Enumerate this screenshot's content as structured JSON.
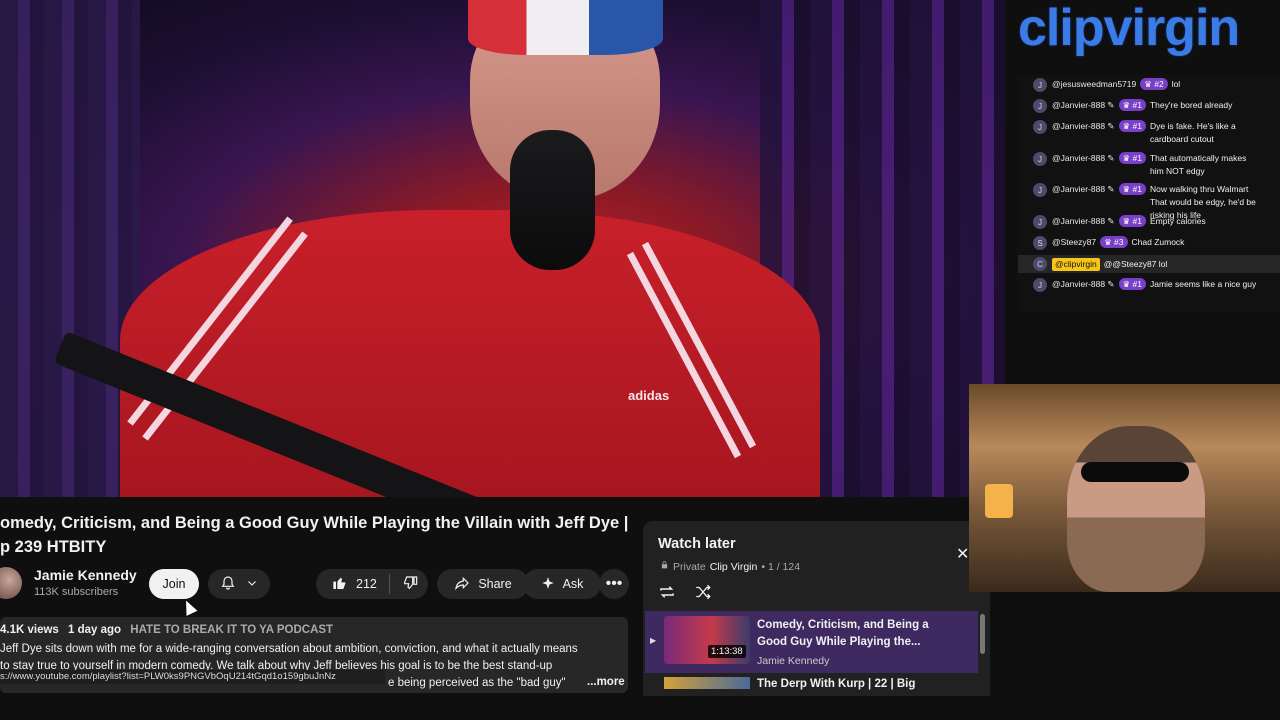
{
  "video": {
    "title_line1": "omedy, Criticism, and Being a Good Guy While Playing the Villain with Jeff Dye |",
    "title_line2": "p 239 HTBITY",
    "overlay_text": "adidas"
  },
  "channel": {
    "name": "Jamie Kennedy",
    "subscribers": "113K subscribers",
    "join_label": "Join"
  },
  "actions": {
    "like_count": "212",
    "share_label": "Share",
    "ask_label": "Ask",
    "more_symbol": "•••"
  },
  "description": {
    "views": "4.1K views",
    "age": "1 day ago",
    "tag": "HATE TO BREAK IT TO YA PODCAST",
    "line1": "Jeff Dye sits down with me for a wide-ranging conversation about ambition, conviction, and what it actually means",
    "line2": "to stay true to yourself in modern comedy. We talk about why Jeff believes his goal is to be the best stand-up",
    "line3": "e being perceived as the \"bad guy\"",
    "more_label": "...more",
    "status_url": "s://www.youtube.com/playlist?list=PLW0ks9PNGVbOqU214tGqd1o159gbuJnNz"
  },
  "watch_later": {
    "title": "Watch later",
    "privacy": "Private",
    "owner": "Clip Virgin",
    "position": "• 1 / 124",
    "close_symbol": "✕",
    "items": [
      {
        "title": "Comedy, Criticism, and Being a Good Guy While Playing the...",
        "channel": "Jamie Kennedy",
        "duration": "1:13:38"
      },
      {
        "title": "The Derp With Kurp | 22 | Big"
      }
    ]
  },
  "overlay": {
    "brand": "clipvirgin",
    "chat": [
      {
        "avatar": "J",
        "user": "@jesusweedman5719",
        "badge": "♛ #2",
        "text": "lol"
      },
      {
        "avatar": "J",
        "user": "@Janvier-888 ✎",
        "badge": "♛ #1",
        "text": "They're bored already"
      },
      {
        "avatar": "J",
        "user": "@Janvier-888 ✎",
        "badge": "♛ #1",
        "text": "Dye is fake. He's like a cardboard cutout"
      },
      {
        "avatar": "J",
        "user": "@Janvier-888 ✎",
        "badge": "♛ #1",
        "text": "That automatically makes him NOT edgy"
      },
      {
        "avatar": "J",
        "user": "@Janvier-888 ✎",
        "badge": "♛ #1",
        "text": "Now walking thru Walmart That would be edgy, he'd be risking his life"
      },
      {
        "avatar": "J",
        "user": "@Janvier-888 ✎",
        "badge": "♛ #1",
        "text": "Empty calories"
      },
      {
        "avatar": "S",
        "user": "@Steezy87",
        "badge": "♛ #3",
        "text": "Chad Zumock"
      },
      {
        "avatar": "C",
        "user": "@clipvirgin",
        "badge": "",
        "text": "@@Steezy87 lol"
      },
      {
        "avatar": "J",
        "user": "@Janvier-888 ✎",
        "badge": "♛ #1",
        "text": "Jamie seems like a nice guy"
      }
    ]
  },
  "colors": {
    "accent": "#3b7be6",
    "chip_bg": "#272727",
    "playlist_highlight": "#3e2a60",
    "chat_badge": "#7a3fc9",
    "host_badge": "#f5c518"
  },
  "icons": {
    "bell": "bell-icon",
    "chevron": "chevron-down-icon",
    "like": "thumbs-up-icon",
    "dislike": "thumbs-down-icon",
    "share": "share-arrow-icon",
    "ask": "sparkle-icon",
    "loop": "loop-icon",
    "shuffle": "shuffle-icon",
    "lock": "lock-icon",
    "play": "play-indicator-icon"
  }
}
